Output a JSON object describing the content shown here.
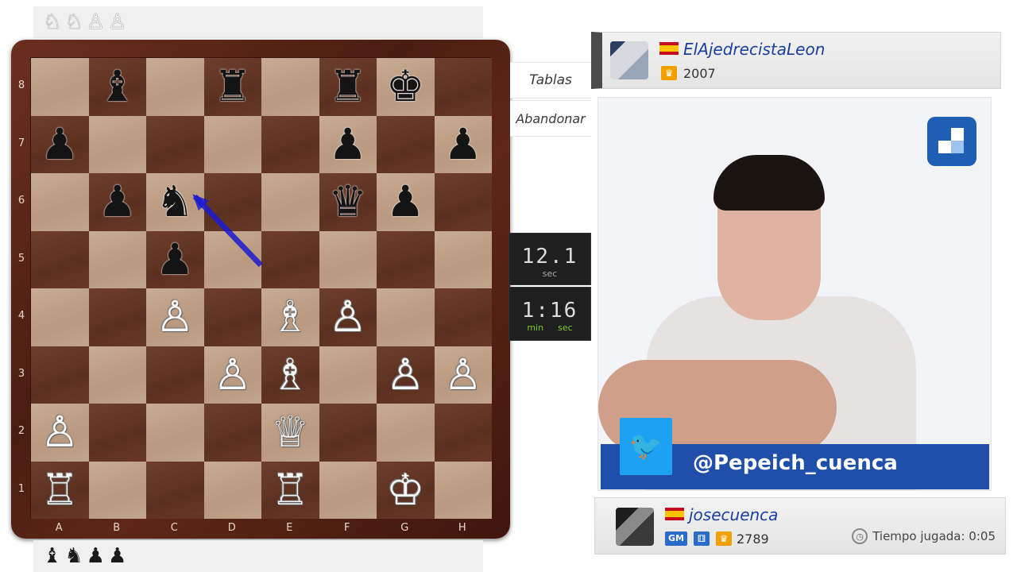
{
  "captured_top": [
    "♘",
    "♘",
    "♙",
    "♙"
  ],
  "captured_bottom": [
    "♝",
    "♞",
    "♟",
    "♟"
  ],
  "board": {
    "ranks": [
      "8",
      "7",
      "6",
      "5",
      "4",
      "3",
      "2",
      "1"
    ],
    "files": [
      "A",
      "B",
      "C",
      "D",
      "E",
      "F",
      "G",
      "H"
    ],
    "rows": [
      [
        "",
        "b:♝",
        "",
        "b:♜",
        "",
        "b:♜",
        "b:♚",
        ""
      ],
      [
        "b:♟",
        "",
        "",
        "",
        "",
        "b:♟",
        "",
        "b:♟"
      ],
      [
        "",
        "b:♟",
        "b:♞",
        "",
        "",
        "b:♛",
        "b:♟",
        ""
      ],
      [
        "",
        "",
        "b:♟",
        "",
        "",
        "",
        "",
        ""
      ],
      [
        "",
        "",
        "w:♙",
        "",
        "w:♗",
        "w:♙",
        "",
        ""
      ],
      [
        "",
        "",
        "",
        "w:♙",
        "w:♗",
        "",
        "w:♙",
        "w:♙"
      ],
      [
        "w:♙",
        "",
        "",
        "",
        "w:♕",
        "",
        "",
        ""
      ],
      [
        "w:♖",
        "",
        "",
        "",
        "w:♖",
        "",
        "w:♔",
        ""
      ]
    ],
    "arrow": {
      "from": "e5",
      "to": "c6",
      "color": "#1b1bd0"
    }
  },
  "buttons": {
    "draw": "Tablas",
    "resign": "Abandonar"
  },
  "clock_opponent": {
    "value": "12.1",
    "unit": "sec"
  },
  "clock_player": {
    "value": "1:16",
    "unit_min": "min",
    "unit_sec": "sec"
  },
  "player_top": {
    "name": "ElAjedrecistaLeon",
    "rating": "2007",
    "flag": "Spain"
  },
  "player_bottom": {
    "name": "josecuenca",
    "title": "GM",
    "rating": "2789",
    "flag": "Spain",
    "time_played": "Tiempo jugada: 0:05"
  },
  "webcam": {
    "twitter_handle": "@Pepeich_cuenca"
  },
  "colors": {
    "name_blue": "#1a3f9c",
    "twitter_blue": "#1da1f2",
    "banner_blue": "#1f4fa8",
    "clock_green": "#7ccb2a"
  }
}
